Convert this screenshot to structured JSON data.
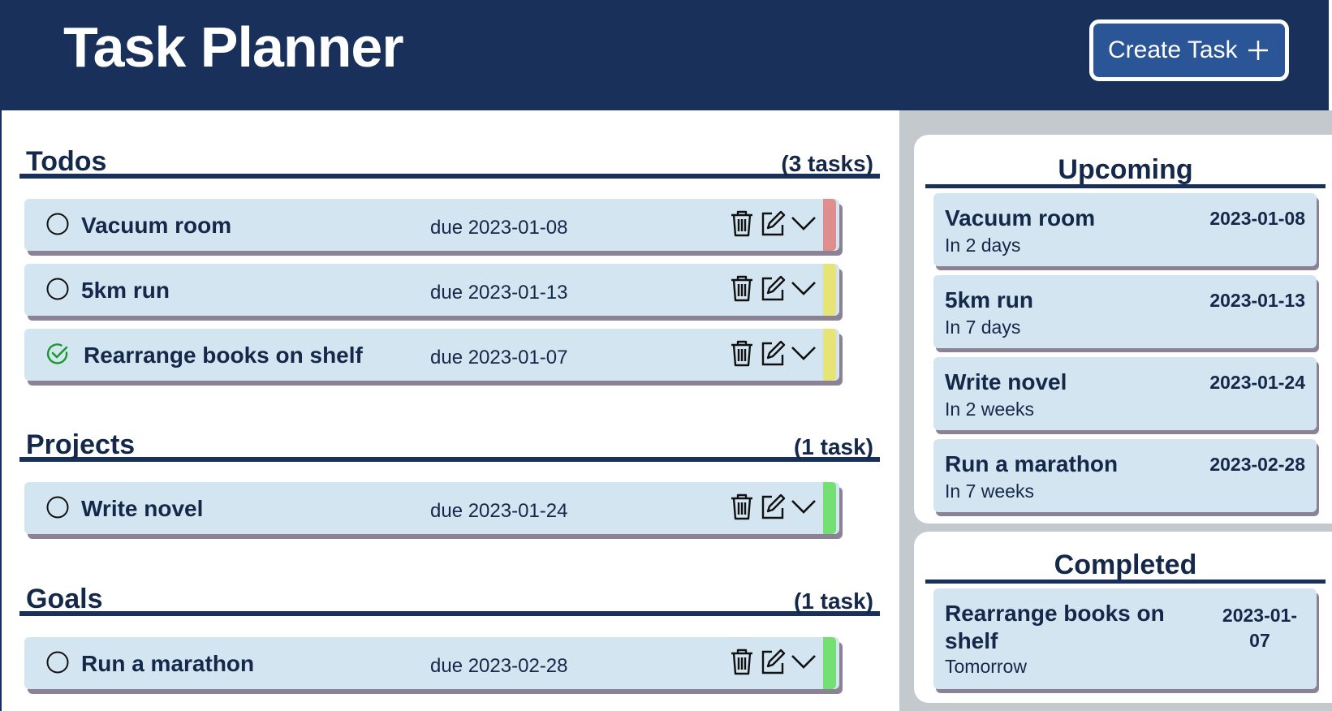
{
  "header": {
    "title": "Task Planner",
    "create_button_label": "Create Task"
  },
  "sections": [
    {
      "title": "Todos",
      "count": "(3 tasks)",
      "tasks": [
        {
          "name": "Vacuum room",
          "due": "due 2023-01-08",
          "completed": false,
          "priority_color": "#e08d8d"
        },
        {
          "name": "5km run",
          "due": "due 2023-01-13",
          "completed": false,
          "priority_color": "#e6e377"
        },
        {
          "name": "Rearrange books on shelf",
          "due": "due 2023-01-07",
          "completed": true,
          "priority_color": "#e6e377"
        }
      ]
    },
    {
      "title": "Projects",
      "count": "(1 task)",
      "tasks": [
        {
          "name": "Write novel",
          "due": "due 2023-01-24",
          "completed": false,
          "priority_color": "#74e074"
        }
      ]
    },
    {
      "title": "Goals",
      "count": "(1 task)",
      "tasks": [
        {
          "name": "Run a marathon",
          "due": "due 2023-02-28",
          "completed": false,
          "priority_color": "#74e074"
        }
      ]
    }
  ],
  "upcoming": {
    "title": "Upcoming",
    "items": [
      {
        "name": "Vacuum room",
        "relative": "In 2 days",
        "date": "2023-01-08"
      },
      {
        "name": "5km run",
        "relative": "In 7 days",
        "date": "2023-01-13"
      },
      {
        "name": "Write novel",
        "relative": "In 2 weeks",
        "date": "2023-01-24"
      },
      {
        "name": "Run a marathon",
        "relative": "In 7 weeks",
        "date": "2023-02-28"
      }
    ]
  },
  "completed": {
    "title": "Completed",
    "items": [
      {
        "name_line1": "Rearrange books on",
        "name_line2": "shelf",
        "relative": "Tomorrow",
        "date_line1": "2023-01-",
        "date_line2": "07"
      }
    ]
  },
  "icons": {
    "check_empty": "circle-icon",
    "check_done": "check-circle-icon",
    "delete": "trash-icon",
    "edit": "edit-icon",
    "expand": "chevron-down-icon",
    "add": "plus-icon"
  },
  "colors": {
    "header_bg": "#18305a",
    "card_bg": "#d3e5f0",
    "accent_button": "#2a5596",
    "check_done": "#1a9a2a"
  }
}
